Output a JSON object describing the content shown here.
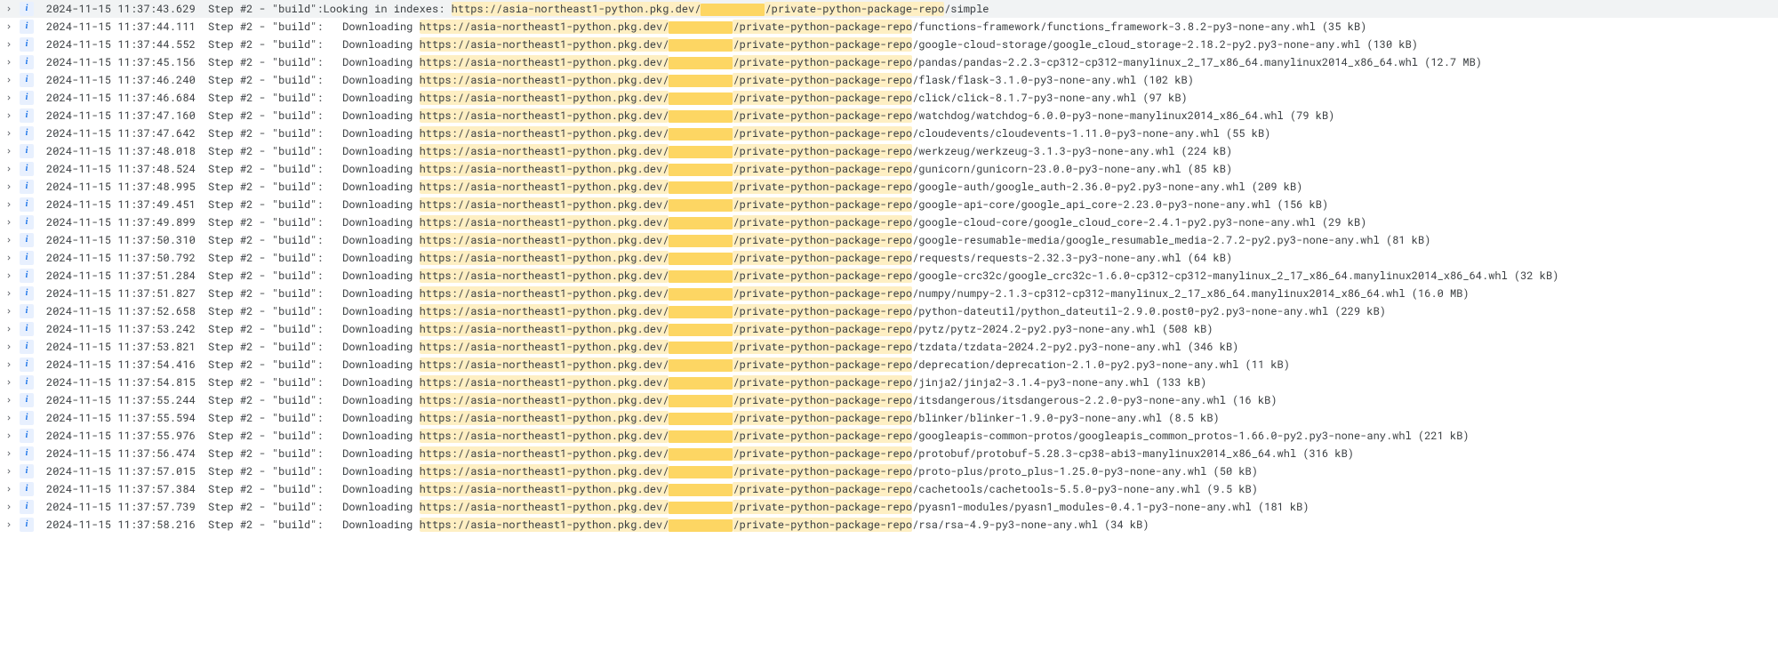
{
  "step_label": "Step #2 - \"build\":",
  "downloading_label": "Downloading",
  "looking_label": "Looking in indexes:",
  "url_prefix": "https://asia-northeast1-python.pkg.dev/",
  "url_repo": "/private-python-package-repo",
  "simple_suffix": "/simple",
  "rows": [
    {
      "ts": "2024-11-15 11:37:43.629",
      "type": "index"
    },
    {
      "ts": "2024-11-15 11:37:44.111",
      "type": "dl",
      "pkg": "/functions-framework/functions_framework-3.8.2-py3-none-any.whl (35 kB)"
    },
    {
      "ts": "2024-11-15 11:37:44.552",
      "type": "dl",
      "pkg": "/google-cloud-storage/google_cloud_storage-2.18.2-py2.py3-none-any.whl (130 kB)"
    },
    {
      "ts": "2024-11-15 11:37:45.156",
      "type": "dl",
      "pkg": "/pandas/pandas-2.2.3-cp312-cp312-manylinux_2_17_x86_64.manylinux2014_x86_64.whl (12.7 MB)"
    },
    {
      "ts": "2024-11-15 11:37:46.240",
      "type": "dl",
      "pkg": "/flask/flask-3.1.0-py3-none-any.whl (102 kB)"
    },
    {
      "ts": "2024-11-15 11:37:46.684",
      "type": "dl",
      "pkg": "/click/click-8.1.7-py3-none-any.whl (97 kB)"
    },
    {
      "ts": "2024-11-15 11:37:47.160",
      "type": "dl",
      "pkg": "/watchdog/watchdog-6.0.0-py3-none-manylinux2014_x86_64.whl (79 kB)"
    },
    {
      "ts": "2024-11-15 11:37:47.642",
      "type": "dl",
      "pkg": "/cloudevents/cloudevents-1.11.0-py3-none-any.whl (55 kB)"
    },
    {
      "ts": "2024-11-15 11:37:48.018",
      "type": "dl",
      "pkg": "/werkzeug/werkzeug-3.1.3-py3-none-any.whl (224 kB)"
    },
    {
      "ts": "2024-11-15 11:37:48.524",
      "type": "dl",
      "pkg": "/gunicorn/gunicorn-23.0.0-py3-none-any.whl (85 kB)"
    },
    {
      "ts": "2024-11-15 11:37:48.995",
      "type": "dl",
      "pkg": "/google-auth/google_auth-2.36.0-py2.py3-none-any.whl (209 kB)"
    },
    {
      "ts": "2024-11-15 11:37:49.451",
      "type": "dl",
      "pkg": "/google-api-core/google_api_core-2.23.0-py3-none-any.whl (156 kB)"
    },
    {
      "ts": "2024-11-15 11:37:49.899",
      "type": "dl",
      "pkg": "/google-cloud-core/google_cloud_core-2.4.1-py2.py3-none-any.whl (29 kB)"
    },
    {
      "ts": "2024-11-15 11:37:50.310",
      "type": "dl",
      "pkg": "/google-resumable-media/google_resumable_media-2.7.2-py2.py3-none-any.whl (81 kB)"
    },
    {
      "ts": "2024-11-15 11:37:50.792",
      "type": "dl",
      "pkg": "/requests/requests-2.32.3-py3-none-any.whl (64 kB)"
    },
    {
      "ts": "2024-11-15 11:37:51.284",
      "type": "dl",
      "pkg": "/google-crc32c/google_crc32c-1.6.0-cp312-cp312-manylinux_2_17_x86_64.manylinux2014_x86_64.whl (32 kB)"
    },
    {
      "ts": "2024-11-15 11:37:51.827",
      "type": "dl",
      "pkg": "/numpy/numpy-2.1.3-cp312-cp312-manylinux_2_17_x86_64.manylinux2014_x86_64.whl (16.0 MB)"
    },
    {
      "ts": "2024-11-15 11:37:52.658",
      "type": "dl",
      "pkg": "/python-dateutil/python_dateutil-2.9.0.post0-py2.py3-none-any.whl (229 kB)"
    },
    {
      "ts": "2024-11-15 11:37:53.242",
      "type": "dl",
      "pkg": "/pytz/pytz-2024.2-py2.py3-none-any.whl (508 kB)"
    },
    {
      "ts": "2024-11-15 11:37:53.821",
      "type": "dl",
      "pkg": "/tzdata/tzdata-2024.2-py2.py3-none-any.whl (346 kB)"
    },
    {
      "ts": "2024-11-15 11:37:54.416",
      "type": "dl",
      "pkg": "/deprecation/deprecation-2.1.0-py2.py3-none-any.whl (11 kB)"
    },
    {
      "ts": "2024-11-15 11:37:54.815",
      "type": "dl",
      "pkg": "/jinja2/jinja2-3.1.4-py3-none-any.whl (133 kB)"
    },
    {
      "ts": "2024-11-15 11:37:55.244",
      "type": "dl",
      "pkg": "/itsdangerous/itsdangerous-2.2.0-py3-none-any.whl (16 kB)"
    },
    {
      "ts": "2024-11-15 11:37:55.594",
      "type": "dl",
      "pkg": "/blinker/blinker-1.9.0-py3-none-any.whl (8.5 kB)"
    },
    {
      "ts": "2024-11-15 11:37:55.976",
      "type": "dl",
      "pkg": "/googleapis-common-protos/googleapis_common_protos-1.66.0-py2.py3-none-any.whl (221 kB)"
    },
    {
      "ts": "2024-11-15 11:37:56.474",
      "type": "dl",
      "pkg": "/protobuf/protobuf-5.28.3-cp38-abi3-manylinux2014_x86_64.whl (316 kB)"
    },
    {
      "ts": "2024-11-15 11:37:57.015",
      "type": "dl",
      "pkg": "/proto-plus/proto_plus-1.25.0-py3-none-any.whl (50 kB)"
    },
    {
      "ts": "2024-11-15 11:37:57.384",
      "type": "dl",
      "pkg": "/cachetools/cachetools-5.5.0-py3-none-any.whl (9.5 kB)"
    },
    {
      "ts": "2024-11-15 11:37:57.739",
      "type": "dl",
      "pkg": "/pyasn1-modules/pyasn1_modules-0.4.1-py3-none-any.whl (181 kB)"
    },
    {
      "ts": "2024-11-15 11:37:58.216",
      "type": "dl",
      "pkg": "/rsa/rsa-4.9-py3-none-any.whl (34 kB)"
    }
  ]
}
